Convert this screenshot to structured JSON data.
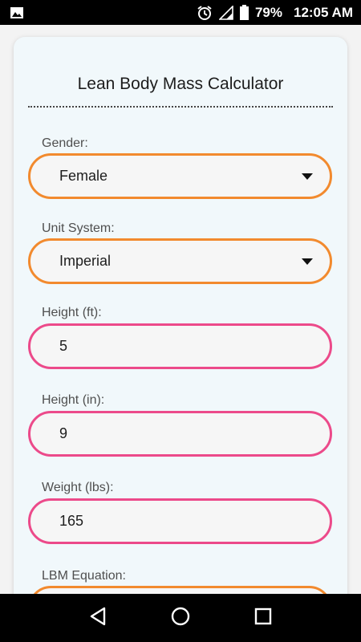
{
  "status_bar": {
    "battery_percent": "79%",
    "time": "12:05 AM",
    "icons": [
      "image-icon",
      "alarm-icon",
      "signal-icon",
      "battery-icon"
    ]
  },
  "app": {
    "title": "Lean Body Mass Calculator",
    "fields": {
      "gender": {
        "label": "Gender:",
        "value": "Female"
      },
      "unit_system": {
        "label": "Unit System:",
        "value": "Imperial"
      },
      "height_ft": {
        "label": "Height (ft):",
        "value": "5"
      },
      "height_in": {
        "label": "Height (in):",
        "value": "9"
      },
      "weight_lbs": {
        "label": "Weight (lbs):",
        "value": "165"
      },
      "lbm_equation": {
        "label": "LBM Equation:",
        "value": ""
      }
    },
    "colors": {
      "select_border": "#f28a2e",
      "input_border": "#ec4a8a",
      "card_background": "#f1f8fb"
    }
  },
  "nav_bar": {
    "icons": [
      "back-icon",
      "home-icon",
      "recents-icon"
    ]
  }
}
